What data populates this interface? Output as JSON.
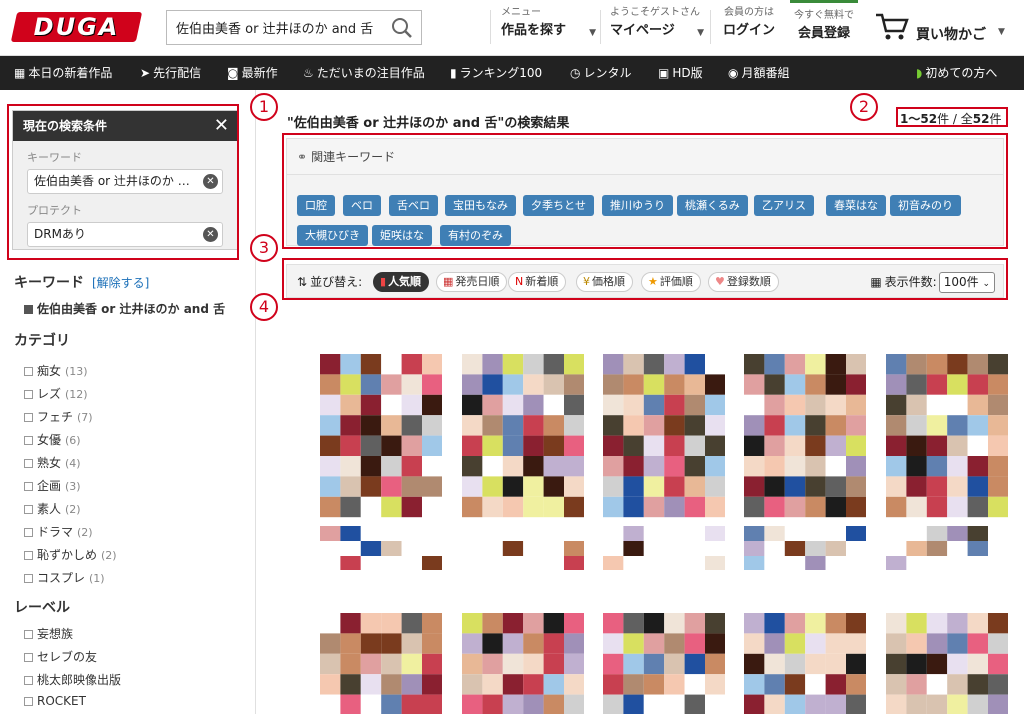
{
  "header": {
    "logo": "DUGA",
    "search_value": "佐伯由美香 or 辻井ほのか and 舌",
    "menu_small": "メニュー",
    "menu_big": "作品を探す",
    "guest_small": "ようこそゲストさん",
    "guest_big": "マイページ",
    "member_small": "会員の方は",
    "member_big": "ログイン",
    "register_small": "今すぐ無料で",
    "register_big": "会員登録",
    "cart_label": "買い物かご"
  },
  "navbar": {
    "items": [
      "本日の新着作品",
      "先行配信",
      "最新作",
      "ただいまの注目作品",
      "ランキング100",
      "レンタル",
      "HD版",
      "月額番組"
    ],
    "right_item": "初めての方へ"
  },
  "sidebar": {
    "cond_title": "現在の検索条件",
    "keyword_label": "キーワード",
    "keyword_value": "佐伯由美香 or 辻井ほのか …",
    "protect_label": "プロテクト",
    "protect_value": "DRMあり",
    "kw_heading": "キーワード",
    "kw_clear": "[解除する]",
    "kw_checked": "佐伯由美香 or 辻井ほのか and 舌",
    "cat_heading": "カテゴリ",
    "categories": [
      {
        "label": "痴女",
        "count": "(13)"
      },
      {
        "label": "レズ",
        "count": "(12)"
      },
      {
        "label": "フェチ",
        "count": "(7)"
      },
      {
        "label": "女優",
        "count": "(6)"
      },
      {
        "label": "熟女",
        "count": "(4)"
      },
      {
        "label": "企画",
        "count": "(3)"
      },
      {
        "label": "素人",
        "count": "(2)"
      },
      {
        "label": "ドラマ",
        "count": "(2)"
      },
      {
        "label": "恥ずかしめ",
        "count": "(2)"
      },
      {
        "label": "コスプレ",
        "count": "(1)"
      }
    ],
    "label_heading": "レーベル",
    "labels": [
      "妄想族",
      "セレブの友",
      "桃太郎映像出版",
      "ROCKET"
    ]
  },
  "main": {
    "result_title": "\"佐伯由美香 or 辻井ほのか and 舌\"の検索結果",
    "count_range": "1〜52",
    "count_unit": "件 / 全",
    "count_total": "52",
    "count_unit2": "件",
    "related_heading": "関連キーワード",
    "related_keywords": [
      "口腔",
      "ベロ",
      "舌ベロ",
      "宝田もなみ",
      "夕季ちとせ",
      "推川ゆうり",
      "桃瀬くるみ",
      "乙アリス",
      "春菜はな",
      "初音みのり",
      "大槻ひびき",
      "姫咲はな",
      "有村のぞみ"
    ],
    "sort_label": "並び替え:",
    "sort_options": [
      "人気順",
      "発売日順",
      "新着順",
      "価格順",
      "評価順",
      "登録数順"
    ],
    "display_label": "表示件数:",
    "display_value": "100件"
  },
  "annotations": [
    "1",
    "2",
    "3",
    "4"
  ],
  "colors": {
    "accent": "#d0021b",
    "tag": "#3f7fb5",
    "nav": "#222222"
  }
}
